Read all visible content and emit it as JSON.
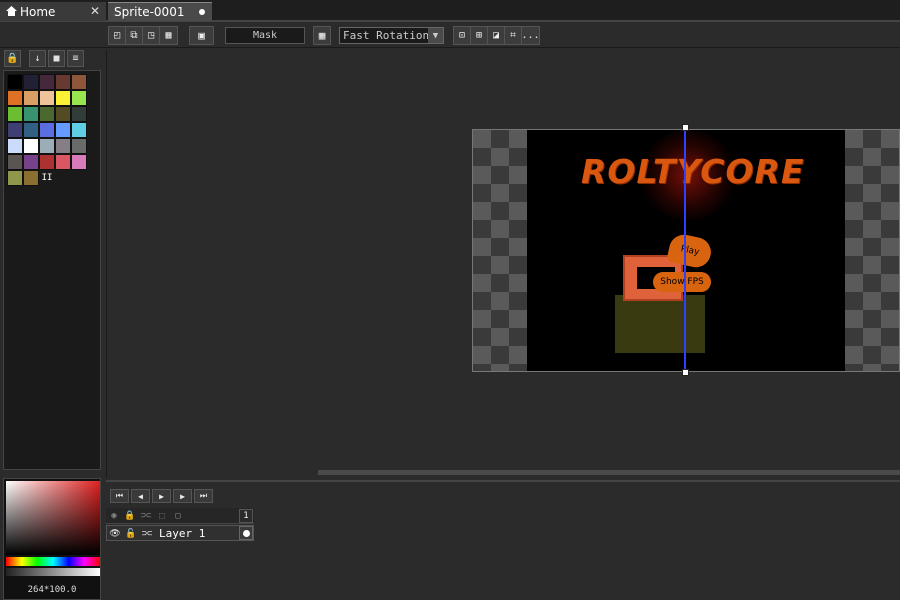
{
  "tabs": [
    {
      "label": "Home",
      "icon": "home-icon",
      "close": "✕"
    },
    {
      "label": "Sprite-0001",
      "modified": true
    }
  ],
  "toolbar": {
    "mask_label": "Mask",
    "rotation_algorithm": "Fast Rotation",
    "more_label": "..."
  },
  "palette": {
    "swatches": [
      "#000000",
      "#222034",
      "#45283c",
      "#663931",
      "#8f563b",
      "#df7126",
      "#d9a066",
      "#eec39a",
      "#fbf236",
      "#99e550",
      "#6abe30",
      "#37946e",
      "#4b692f",
      "#524b24",
      "#323c39",
      "#3f3f74",
      "#306082",
      "#5b6ee1",
      "#639bff",
      "#5fcde4",
      "#cbdbfc",
      "#ffffff",
      "#9badb7",
      "#847e87",
      "#696a6a",
      "#595652",
      "#76428a",
      "#ac3232",
      "#d95763",
      "#d77bba",
      "#8f974a",
      "#8a6f30"
    ],
    "more_label": "II"
  },
  "color_picker": {
    "readout": "264*100.0"
  },
  "sprite": {
    "logo_text": "ROLTYCORE",
    "play_label": "Play",
    "fps_label": "Show FPS"
  },
  "timeline": {
    "frame_number": "1",
    "layer_name": "Layer 1"
  },
  "colors": {
    "accent_blue": "#3040ff",
    "logo_orange": "#d9570f",
    "background": "#2b2b2b"
  }
}
